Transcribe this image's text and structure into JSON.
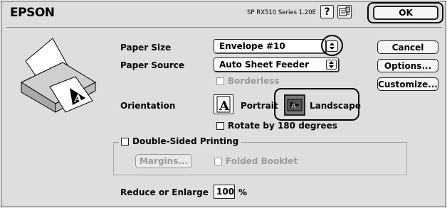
{
  "header": {
    "brand": "EPSON",
    "version": "SP RX510 Series 1.20E",
    "help_icon_glyph": "?",
    "ok_label": "OK"
  },
  "buttons": {
    "cancel_label": "Cancel",
    "options_label": "Options...",
    "customize_label": "Customize..."
  },
  "paper": {
    "size_label": "Paper Size",
    "size_value": "Envelope #10",
    "source_label": "Paper Source",
    "source_value": "Auto Sheet Feeder",
    "borderless_label": "Borderless",
    "borderless_checked": false,
    "borderless_enabled": false
  },
  "orientation": {
    "label": "Orientation",
    "portrait_label": "Portrait",
    "landscape_label": "Landscape",
    "selected": "Landscape",
    "rotate_label": "Rotate by 180 degrees",
    "rotate_checked": false
  },
  "duplex": {
    "label": "Double-Sided Printing",
    "checked": false,
    "margins_label": "Margins...",
    "folded_booklet_label": "Folded Booklet",
    "folded_booklet_checked": false
  },
  "scale": {
    "label": "Reduce or Enlarge",
    "value": "100",
    "unit": "%"
  },
  "colors": {
    "dialog_bg": "#dedede",
    "disabled_text": "#9a9a9a",
    "highlight": "#000000"
  },
  "icons": {
    "printer": "printer-illustration-icon",
    "help": "help-icon",
    "settings": "printer-settings-icon",
    "portrait": "portrait-orientation-icon",
    "landscape": "landscape-orientation-icon"
  }
}
